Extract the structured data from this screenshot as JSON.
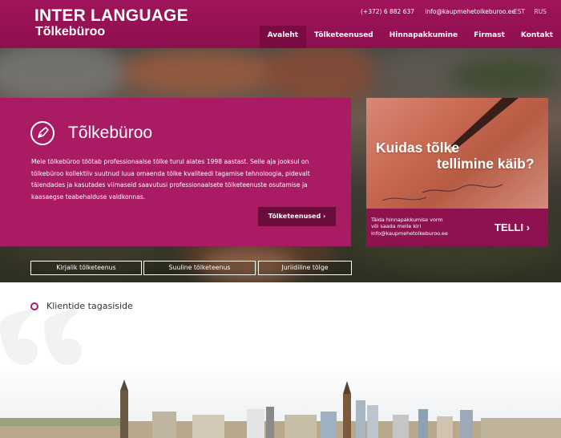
{
  "header": {
    "logo_line1": "INTER LANGUAGE",
    "logo_line2": "Tõlkebüroo",
    "phone": "(+372) 6 882 637",
    "email": "info@kaupmehetolkeburoo.ee",
    "languages": [
      "EST",
      "RUS"
    ],
    "nav": [
      {
        "label": "Avaleht",
        "active": true
      },
      {
        "label": "Tõlketeenused",
        "active": false
      },
      {
        "label": "Hinnapakkumine",
        "active": false
      },
      {
        "label": "Firmast",
        "active": false
      },
      {
        "label": "Kontakt",
        "active": false
      }
    ]
  },
  "hero": {
    "title": "Tõlkebüroo",
    "icon": "pen-nib-icon",
    "text": "Meie tõlkebüroo töötab professionaalse tõlke turul alates 1998 aastast. Selle aja jooksul on tõlkebüroo kollektiiv suutnud luua omaenda tõlke kvaliteedi tagamise tehnoloogia, pidevalt täiendades ja kasutades viimaseid saavutusi professionaalsete tõlketeenuste osutamise ja kaasaegse teabehalduse valdkonnas.",
    "button": "Tõlketeenused  ›"
  },
  "card": {
    "heading_line1": "Kuidas tõlke",
    "heading_line2": "tellimine käib?",
    "small_line1": "Täida hinnapakkumise vorm",
    "small_line2": "või saada meile kiri",
    "small_line3": "info@kaupmehetolkeburoo.ee",
    "cta": "TELLI  ›"
  },
  "services": [
    "Kirjalik tõlketeenus",
    "Suuline tõlketeenus",
    "Juriidiline tõlge"
  ],
  "testimonials": {
    "title": "Klientide tagasiside"
  },
  "colors": {
    "brand": "#a91b63",
    "brand_dark": "#8c0f4e",
    "button_dark": "#6a0d3a"
  }
}
